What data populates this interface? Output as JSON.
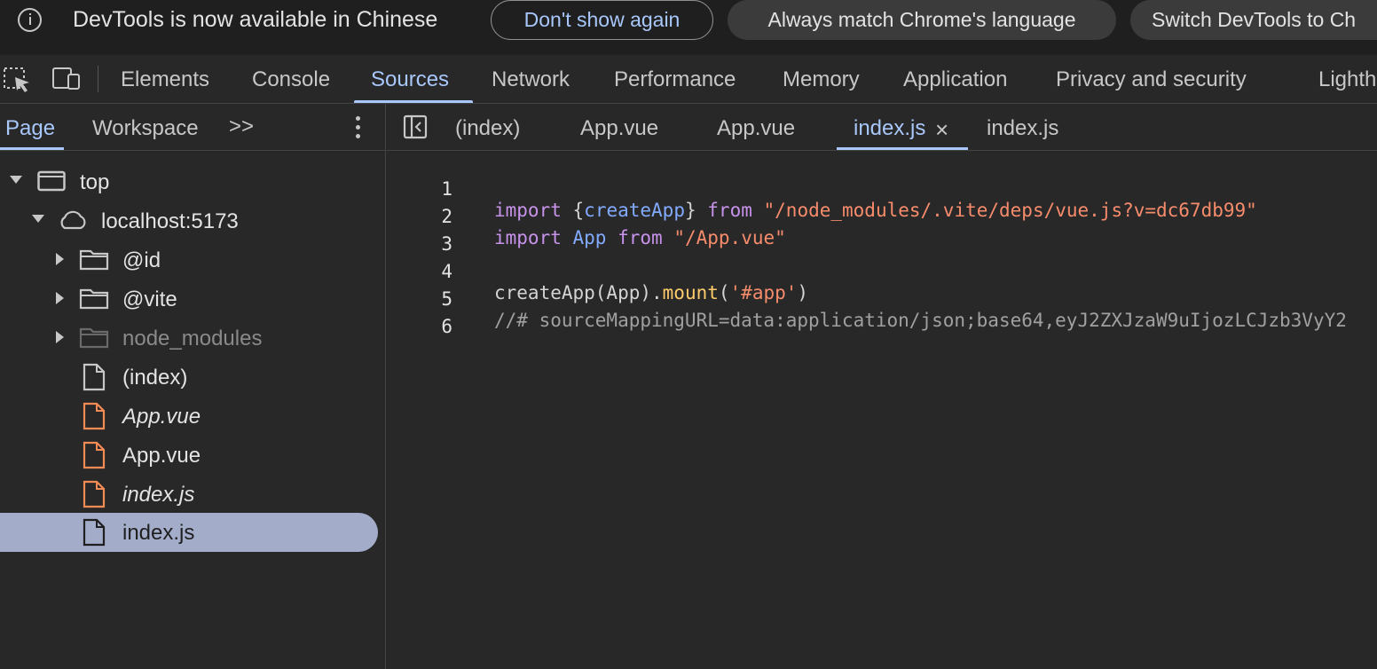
{
  "infobar": {
    "message": "DevTools is now available in Chinese",
    "dont_show": "Don't show again",
    "always_match": "Always match Chrome's language",
    "switch": "Switch DevTools to Ch"
  },
  "toolbar": {
    "tabs": [
      "Elements",
      "Console",
      "Sources",
      "Network",
      "Performance",
      "Memory",
      "Application",
      "Privacy and security",
      "Lighth"
    ],
    "active_tab": "Sources"
  },
  "navigator": {
    "tabs": [
      "Page",
      "Workspace"
    ],
    "more": ">>",
    "tree": [
      {
        "label": "top"
      },
      {
        "label": "localhost:5173"
      },
      {
        "label": "@id"
      },
      {
        "label": "@vite"
      },
      {
        "label": "node_modules"
      },
      {
        "label": "(index)"
      },
      {
        "label": "App.vue"
      },
      {
        "label": "App.vue"
      },
      {
        "label": "index.js"
      },
      {
        "label": "index.js"
      }
    ]
  },
  "editor": {
    "tabs": [
      "(index)",
      "App.vue",
      "App.vue",
      "index.js",
      "index.js"
    ],
    "active_tab": "index.js",
    "close": "×",
    "lines": [
      {
        "num": "1",
        "tokens": [
          "import",
          " ",
          "{",
          "createApp",
          "}",
          " ",
          "from",
          " ",
          "\"/node_modules/.vite/deps/vue.js?v=dc67db99\""
        ]
      },
      {
        "num": "2",
        "tokens": [
          "import",
          " ",
          "App",
          " ",
          "from",
          " ",
          "\"/App.vue\""
        ]
      },
      {
        "num": "3",
        "tokens": []
      },
      {
        "num": "4",
        "tokens": [
          "createApp(App).",
          "mount",
          "(",
          "'#app'",
          ")"
        ]
      },
      {
        "num": "5",
        "tokens": [
          "//# sourceMappingURL=data:application/json;base64,eyJ2ZXJzaW9uIjozLCJzb3VyY2"
        ]
      },
      {
        "num": "6",
        "tokens": []
      }
    ]
  },
  "colors": {
    "accent": "#a8c7fa",
    "keyword": "#c792ea",
    "string": "#f78c6c",
    "function": "#ffcb6b",
    "selected_row": "#a3acc9",
    "vue_file": "#f28b54"
  }
}
